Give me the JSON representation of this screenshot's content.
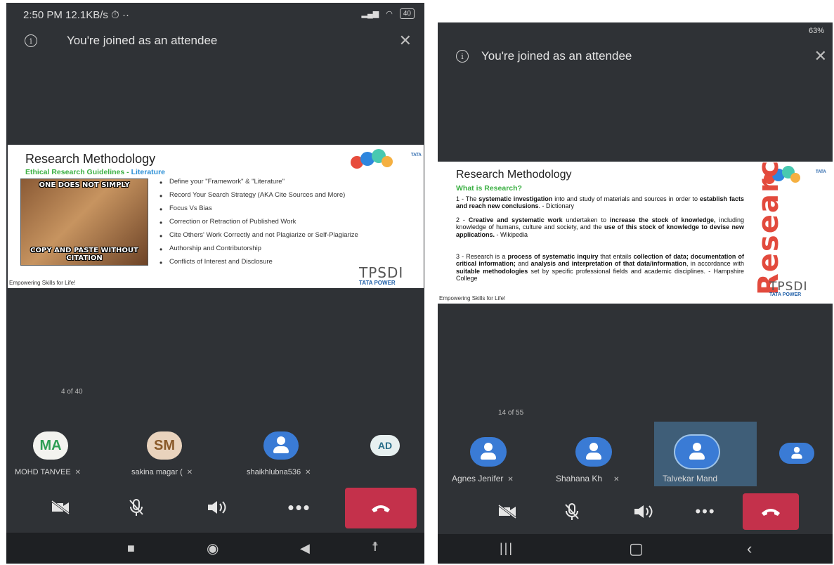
{
  "left": {
    "status": {
      "time": "2:50 PM",
      "speed": "12.1KB/s",
      "battery": "40"
    },
    "banner": {
      "text": "You're joined as an attendee"
    },
    "slide": {
      "title": "Research Methodology",
      "subtitle_a": "Ethical Research Guidelines",
      "subtitle_sep": " - ",
      "subtitle_b": "Literature",
      "meme_top": "ONE DOES NOT SIMPLY",
      "meme_bottom": "COPY AND PASTE WITHOUT CITATION",
      "bullets": [
        "Define your \"Framework\" & \"Literature\"",
        "Record Your Search Strategy (AKA Cite Sources and More)",
        "Focus Vs Bias",
        "Correction or Retraction of Published Work",
        "Cite Others' Work Correctly and not Plagiarize or Self-Plagiarize",
        "Authorship and Contributorship",
        "Conflicts of Interest and Disclosure"
      ],
      "footer": "Empowering Skills for Life!",
      "logo_tpsdi": "TPSDI",
      "logo_tata": "TATA POWER",
      "tata_mark": "TATA"
    },
    "counter": "4 of 40",
    "participants": [
      {
        "initials": "MA",
        "name": "MOHD TANVEE"
      },
      {
        "initials": "SM",
        "name": "sakina magar ("
      },
      {
        "initials": "",
        "name": "shaikhlubna536"
      },
      {
        "initials": "AD",
        "name": ""
      }
    ]
  },
  "right": {
    "status": {
      "battery": "63%"
    },
    "banner": {
      "text": "You're joined as an attendee"
    },
    "slide": {
      "title": "Research Methodology",
      "subtitle": "What is Research?",
      "p1_a": "1 - The ",
      "p1_b": "systematic investigation",
      "p1_c": " into and study of materials and sources in order to ",
      "p1_d": "establish facts and reach new conclusions",
      "p1_e": ". - Dictionary",
      "p2_a": "2 - ",
      "p2_b": "Creative and systematic work",
      "p2_c": " undertaken to ",
      "p2_d": "increase the stock of knowledge,",
      "p2_e": " including knowledge of humans, culture and society, and the ",
      "p2_f": "use of this stock of knowledge to devise new applications.",
      "p2_g": " - Wikipedia",
      "p3_a": "3 - Research is a ",
      "p3_b": "process of systematic inquiry",
      "p3_c": " that entails ",
      "p3_d": "collection of data; documentation of critical information;",
      "p3_e": " and ",
      "p3_f": "analysis and interpretation of that data/information",
      "p3_g": ", in accordance with ",
      "p3_h": "suitable methodologies",
      "p3_i": " set by specific professional fields and academic disciplines. - Hampshire College",
      "footer": "Empowering Skills for Life!",
      "art": "Research",
      "logo_tpsdi": "TPSDI",
      "logo_tata": "TATA POWER",
      "tata_mark": "TATA"
    },
    "counter": "14 of 55",
    "participants": [
      {
        "name": "Agnes Jenifer"
      },
      {
        "name": "Shahana Kh"
      },
      {
        "name": "Talvekar Mand"
      },
      {
        "name": ""
      }
    ]
  },
  "colors": {
    "hangup": "#c4314b",
    "avatar_blue": "#3a7bd5",
    "bg": "#2f3236"
  }
}
